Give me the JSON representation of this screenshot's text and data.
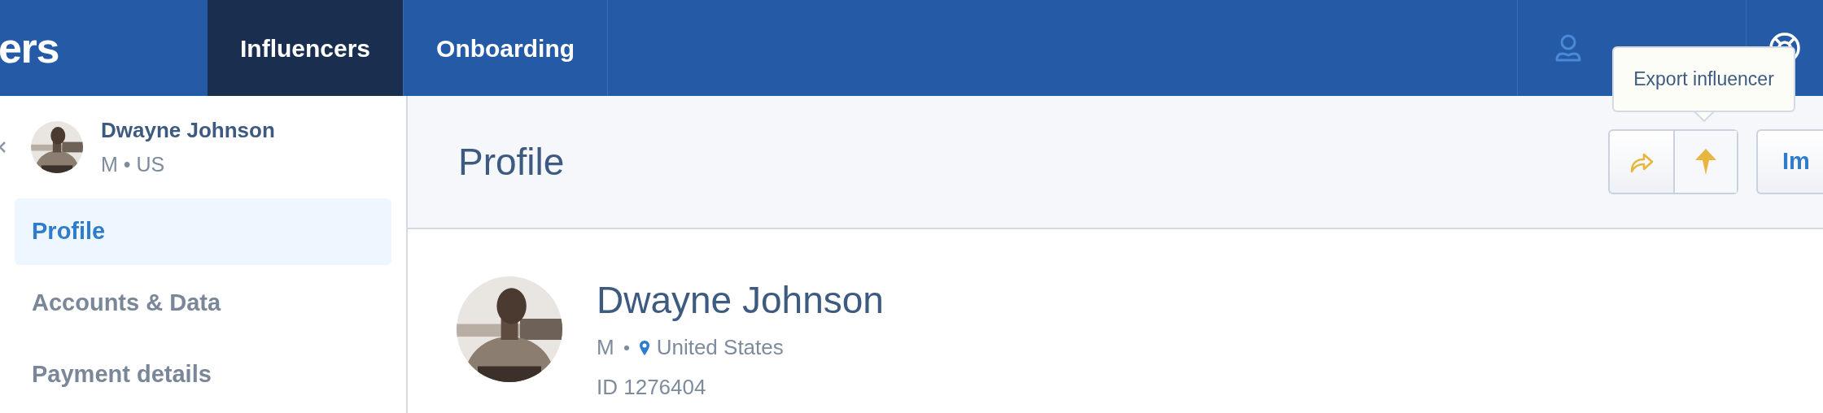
{
  "brand": {
    "text": "ers"
  },
  "nav": {
    "tabs": [
      {
        "label": "Influencers",
        "selected": true
      },
      {
        "label": "Onboarding",
        "selected": false
      }
    ]
  },
  "sidebar": {
    "influencer": {
      "name": "Dwayne Johnson",
      "meta": "M • US"
    },
    "items": [
      {
        "label": "Profile",
        "selected": true
      },
      {
        "label": "Accounts & Data",
        "selected": false
      },
      {
        "label": "Payment details",
        "selected": false
      }
    ]
  },
  "main": {
    "title": "Profile",
    "tooltip": "Export influencer",
    "actions": [
      {
        "kind": "share"
      },
      {
        "kind": "export"
      }
    ],
    "primary_button": "Im",
    "profile": {
      "name": "Dwayne Johnson",
      "gender": "M",
      "location": "United States",
      "id": "ID 1276404"
    }
  }
}
